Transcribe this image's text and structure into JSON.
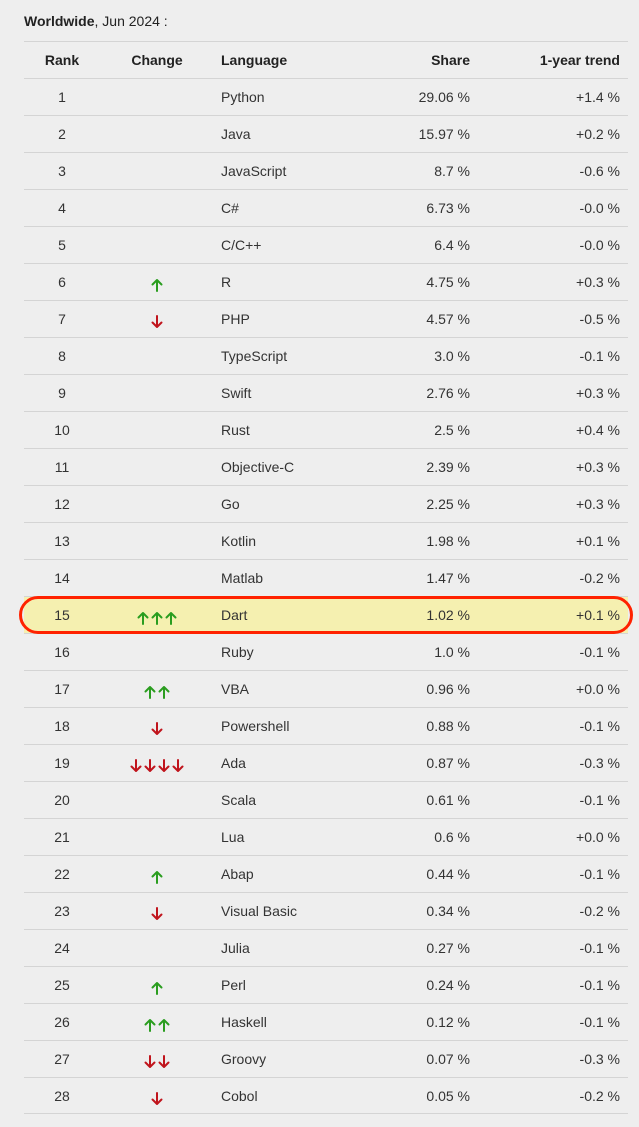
{
  "heading": {
    "region": "Worldwide",
    "date": ", Jun 2024 :"
  },
  "columns": {
    "rank": "Rank",
    "change": "Change",
    "language": "Language",
    "share": "Share",
    "trend": "1-year trend"
  },
  "colors": {
    "up_arrow": "#2a9d1f",
    "down_arrow": "#c0141c",
    "highlight_fill": "#f5f0b0",
    "highlight_ring": "#ff2200"
  },
  "highlighted_rank": "15",
  "rows": [
    {
      "rank": "1",
      "change": {
        "dir": "",
        "count": 0
      },
      "language": "Python",
      "share": "29.06 %",
      "trend": "+1.4 %"
    },
    {
      "rank": "2",
      "change": {
        "dir": "",
        "count": 0
      },
      "language": "Java",
      "share": "15.97 %",
      "trend": "+0.2 %"
    },
    {
      "rank": "3",
      "change": {
        "dir": "",
        "count": 0
      },
      "language": "JavaScript",
      "share": "8.7 %",
      "trend": "-0.6 %"
    },
    {
      "rank": "4",
      "change": {
        "dir": "",
        "count": 0
      },
      "language": "C#",
      "share": "6.73 %",
      "trend": "-0.0 %"
    },
    {
      "rank": "5",
      "change": {
        "dir": "",
        "count": 0
      },
      "language": "C/C++",
      "share": "6.4 %",
      "trend": "-0.0 %"
    },
    {
      "rank": "6",
      "change": {
        "dir": "up",
        "count": 1
      },
      "language": "R",
      "share": "4.75 %",
      "trend": "+0.3 %"
    },
    {
      "rank": "7",
      "change": {
        "dir": "down",
        "count": 1
      },
      "language": "PHP",
      "share": "4.57 %",
      "trend": "-0.5 %"
    },
    {
      "rank": "8",
      "change": {
        "dir": "",
        "count": 0
      },
      "language": "TypeScript",
      "share": "3.0 %",
      "trend": "-0.1 %"
    },
    {
      "rank": "9",
      "change": {
        "dir": "",
        "count": 0
      },
      "language": "Swift",
      "share": "2.76 %",
      "trend": "+0.3 %"
    },
    {
      "rank": "10",
      "change": {
        "dir": "",
        "count": 0
      },
      "language": "Rust",
      "share": "2.5 %",
      "trend": "+0.4 %"
    },
    {
      "rank": "11",
      "change": {
        "dir": "",
        "count": 0
      },
      "language": "Objective-C",
      "share": "2.39 %",
      "trend": "+0.3 %"
    },
    {
      "rank": "12",
      "change": {
        "dir": "",
        "count": 0
      },
      "language": "Go",
      "share": "2.25 %",
      "trend": "+0.3 %"
    },
    {
      "rank": "13",
      "change": {
        "dir": "",
        "count": 0
      },
      "language": "Kotlin",
      "share": "1.98 %",
      "trend": "+0.1 %"
    },
    {
      "rank": "14",
      "change": {
        "dir": "",
        "count": 0
      },
      "language": "Matlab",
      "share": "1.47 %",
      "trend": "-0.2 %"
    },
    {
      "rank": "15",
      "change": {
        "dir": "up",
        "count": 3
      },
      "language": "Dart",
      "share": "1.02 %",
      "trend": "+0.1 %"
    },
    {
      "rank": "16",
      "change": {
        "dir": "",
        "count": 0
      },
      "language": "Ruby",
      "share": "1.0 %",
      "trend": "-0.1 %"
    },
    {
      "rank": "17",
      "change": {
        "dir": "up",
        "count": 2
      },
      "language": "VBA",
      "share": "0.96 %",
      "trend": "+0.0 %"
    },
    {
      "rank": "18",
      "change": {
        "dir": "down",
        "count": 1
      },
      "language": "Powershell",
      "share": "0.88 %",
      "trend": "-0.1 %"
    },
    {
      "rank": "19",
      "change": {
        "dir": "down",
        "count": 4
      },
      "language": "Ada",
      "share": "0.87 %",
      "trend": "-0.3 %"
    },
    {
      "rank": "20",
      "change": {
        "dir": "",
        "count": 0
      },
      "language": "Scala",
      "share": "0.61 %",
      "trend": "-0.1 %"
    },
    {
      "rank": "21",
      "change": {
        "dir": "",
        "count": 0
      },
      "language": "Lua",
      "share": "0.6 %",
      "trend": "+0.0 %"
    },
    {
      "rank": "22",
      "change": {
        "dir": "up",
        "count": 1
      },
      "language": "Abap",
      "share": "0.44 %",
      "trend": "-0.1 %"
    },
    {
      "rank": "23",
      "change": {
        "dir": "down",
        "count": 1
      },
      "language": "Visual Basic",
      "share": "0.34 %",
      "trend": "-0.2 %"
    },
    {
      "rank": "24",
      "change": {
        "dir": "",
        "count": 0
      },
      "language": "Julia",
      "share": "0.27 %",
      "trend": "-0.1 %"
    },
    {
      "rank": "25",
      "change": {
        "dir": "up",
        "count": 1
      },
      "language": "Perl",
      "share": "0.24 %",
      "trend": "-0.1 %"
    },
    {
      "rank": "26",
      "change": {
        "dir": "up",
        "count": 2
      },
      "language": "Haskell",
      "share": "0.12 %",
      "trend": "-0.1 %"
    },
    {
      "rank": "27",
      "change": {
        "dir": "down",
        "count": 2
      },
      "language": "Groovy",
      "share": "0.07 %",
      "trend": "-0.3 %"
    },
    {
      "rank": "28",
      "change": {
        "dir": "down",
        "count": 1
      },
      "language": "Cobol",
      "share": "0.05 %",
      "trend": "-0.2 %"
    }
  ]
}
